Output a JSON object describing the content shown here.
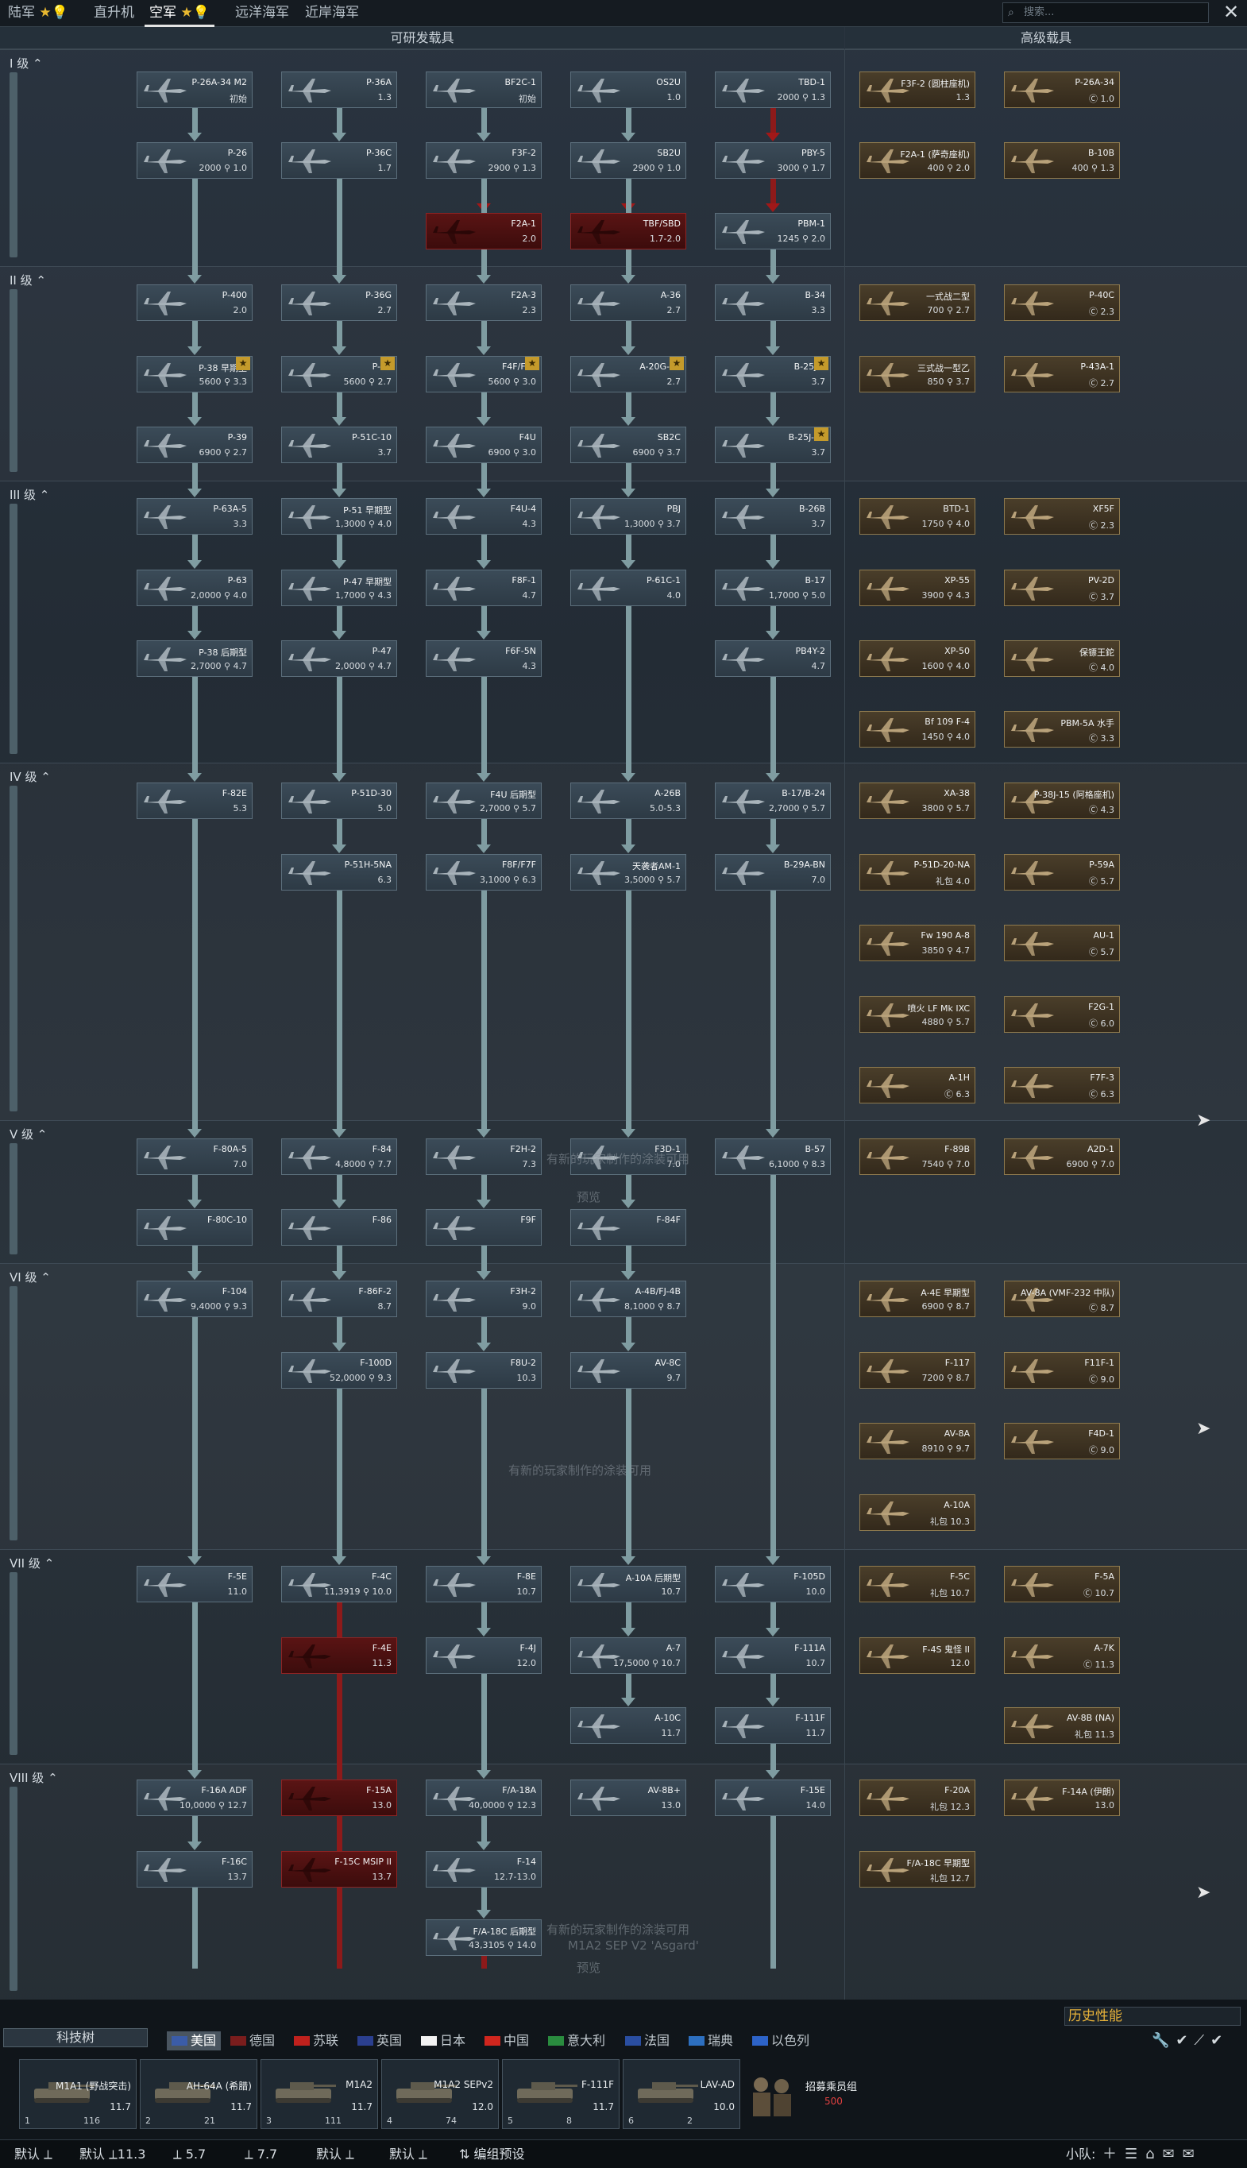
{
  "top_tabs": [
    {
      "label": "陆军",
      "badges": [
        "★",
        "💡"
      ],
      "active": false
    },
    {
      "label": "直升机",
      "badges": [],
      "active": false
    },
    {
      "label": "空军",
      "badges": [
        "★",
        "💡"
      ],
      "active": true
    },
    {
      "label": "远洋海军",
      "badges": [],
      "active": false
    },
    {
      "label": "近岸海军",
      "badges": [],
      "active": false
    }
  ],
  "search": {
    "placeholder": "搜索..."
  },
  "close_label": "✕",
  "headers": {
    "researchable": "可研发载具",
    "premium": "高级载具"
  },
  "ranks": [
    "I 级",
    "II 级",
    "III 级",
    "IV 级",
    "V 级",
    "VI 级",
    "VII 级",
    "VIII 级"
  ],
  "vehicles": [
    {
      "name": "P-26A-34 M2",
      "value": "初始",
      "type": "n"
    },
    {
      "name": "P-36A",
      "value": "1.3",
      "type": "n"
    },
    {
      "name": "BF2C-1",
      "value": "初始",
      "type": "n"
    },
    {
      "name": "OS2U",
      "value": "1.0",
      "type": "n"
    },
    {
      "name": "TBD-1",
      "value": "2000 ⚲ 1.3",
      "type": "n"
    },
    {
      "name": "F3F-2 (圆柱座机)",
      "value": "1.3",
      "type": "p"
    },
    {
      "name": "P-26A-34",
      "value": "Ⓒ 1.0",
      "type": "p"
    },
    {
      "name": "P-26",
      "value": "2000 ⚲ 1.0",
      "type": "n"
    },
    {
      "name": "P-36C",
      "value": "1.7",
      "type": "n"
    },
    {
      "name": "F3F-2",
      "value": "2900 ⚲ 1.3",
      "type": "n"
    },
    {
      "name": "SB2U",
      "value": "2900 ⚲ 1.0",
      "type": "n"
    },
    {
      "name": "PBY-5",
      "value": "3000 ⚲ 1.7",
      "type": "n"
    },
    {
      "name": "F2A-1 (萨奇座机)",
      "value": "400 ⚲ 2.0",
      "type": "p"
    },
    {
      "name": "B-10B",
      "value": "400 ⚲ 1.3",
      "type": "p"
    },
    {
      "name": "F2A-1",
      "value": "2.0",
      "type": "l"
    },
    {
      "name": "TBF/SBD",
      "value": "1.7-2.0",
      "type": "l"
    },
    {
      "name": "PBM-1",
      "value": "1245 ⚲ 2.0",
      "type": "n"
    },
    {
      "name": "P-400",
      "value": "2.0",
      "type": "n"
    },
    {
      "name": "P-36G",
      "value": "2.7",
      "type": "n"
    },
    {
      "name": "F2A-3",
      "value": "2.3",
      "type": "n"
    },
    {
      "name": "A-36",
      "value": "2.7",
      "type": "n"
    },
    {
      "name": "B-34",
      "value": "3.3",
      "type": "n"
    },
    {
      "name": "一式战二型",
      "value": "700 ⚲ 2.7",
      "type": "p"
    },
    {
      "name": "P-40C",
      "value": "Ⓒ 2.3",
      "type": "p"
    },
    {
      "name": "P-38 早期型",
      "value": "5600 ⚲ 3.3",
      "type": "n"
    },
    {
      "name": "P-40",
      "value": "5600 ⚲ 2.7",
      "type": "n"
    },
    {
      "name": "F4F/F6F",
      "value": "5600 ⚲ 3.0",
      "type": "n"
    },
    {
      "name": "A-20G-25",
      "value": "2.7",
      "type": "n"
    },
    {
      "name": "B-25J-1",
      "value": "3.7",
      "type": "n"
    },
    {
      "name": "三式战一型乙",
      "value": "850 ⚲ 3.7",
      "type": "p"
    },
    {
      "name": "P-43A-1",
      "value": "Ⓒ 2.7",
      "type": "p"
    },
    {
      "name": "P-39",
      "value": "6900 ⚲ 2.7",
      "type": "n"
    },
    {
      "name": "P-51C-10",
      "value": "3.7",
      "type": "n"
    },
    {
      "name": "F4U",
      "value": "6900 ⚲ 3.0",
      "type": "n"
    },
    {
      "name": "SB2C",
      "value": "6900 ⚲ 3.7",
      "type": "n"
    },
    {
      "name": "B-25J-20",
      "value": "3.7",
      "type": "n"
    },
    {
      "name": "P-63A-5",
      "value": "3.3",
      "type": "n"
    },
    {
      "name": "P-51 早期型",
      "value": "1,3000 ⚲ 4.0",
      "type": "n"
    },
    {
      "name": "F4U-4",
      "value": "4.3",
      "type": "n"
    },
    {
      "name": "PBJ",
      "value": "1,3000 ⚲ 3.7",
      "type": "n"
    },
    {
      "name": "B-26B",
      "value": "3.7",
      "type": "n"
    },
    {
      "name": "BTD-1",
      "value": "1750 ⚲ 4.0",
      "type": "p"
    },
    {
      "name": "XF5F",
      "value": "Ⓒ 2.3",
      "type": "p"
    },
    {
      "name": "P-63",
      "value": "2,0000 ⚲ 4.0",
      "type": "n"
    },
    {
      "name": "P-47 早期型",
      "value": "1,7000 ⚲ 4.3",
      "type": "n"
    },
    {
      "name": "F8F-1",
      "value": "4.7",
      "type": "n"
    },
    {
      "name": "P-61C-1",
      "value": "4.0",
      "type": "n"
    },
    {
      "name": "B-17",
      "value": "1,7000 ⚲ 5.0",
      "type": "n"
    },
    {
      "name": "XP-55",
      "value": "3900 ⚲ 4.3",
      "type": "p"
    },
    {
      "name": "PV-2D",
      "value": "Ⓒ 3.7",
      "type": "p"
    },
    {
      "name": "P-38 后期型",
      "value": "2,7000 ⚲ 4.7",
      "type": "n"
    },
    {
      "name": "P-47",
      "value": "2,0000 ⚲ 4.7",
      "type": "n"
    },
    {
      "name": "F6F-5N",
      "value": "4.3",
      "type": "n"
    },
    {
      "name": "PB4Y-2",
      "value": "4.7",
      "type": "n"
    },
    {
      "name": "XP-50",
      "value": "1600 ⚲ 4.0",
      "type": "p"
    },
    {
      "name": "保镖王鉈",
      "value": "Ⓒ 4.0",
      "type": "p"
    },
    {
      "name": "Bf 109 F-4",
      "value": "1450 ⚲ 4.0",
      "type": "p"
    },
    {
      "name": "PBM-5A 水手",
      "value": "Ⓒ 3.3",
      "type": "p"
    },
    {
      "name": "F-82E",
      "value": "5.3",
      "type": "n"
    },
    {
      "name": "P-51D-30",
      "value": "5.0",
      "type": "n"
    },
    {
      "name": "F4U 后期型",
      "value": "2,7000 ⚲ 5.7",
      "type": "n"
    },
    {
      "name": "A-26B",
      "value": "5.0-5.3",
      "type": "n"
    },
    {
      "name": "B-17/B-24",
      "value": "2,7000 ⚲ 5.7",
      "type": "n"
    },
    {
      "name": "XA-38",
      "value": "3800 ⚲ 5.7",
      "type": "p"
    },
    {
      "name": "P-38J-15 (阿格座机)",
      "value": "Ⓒ 4.3",
      "type": "p"
    },
    {
      "name": "P-51H-5NA",
      "value": "6.3",
      "type": "n"
    },
    {
      "name": "F8F/F7F",
      "value": "3,1000 ⚲ 6.3",
      "type": "n"
    },
    {
      "name": "天袭者AM-1",
      "value": "3,5000 ⚲ 5.7",
      "type": "n"
    },
    {
      "name": "B-29A-BN",
      "value": "7.0",
      "type": "n"
    },
    {
      "name": "P-51D-20-NA",
      "value": "礼包 4.0",
      "type": "p"
    },
    {
      "name": "P-59A",
      "value": "Ⓒ 5.7",
      "type": "p"
    },
    {
      "name": "Fw 190 A-8",
      "value": "3850 ⚲ 4.7",
      "type": "p"
    },
    {
      "name": "AU-1",
      "value": "Ⓒ 5.7",
      "type": "p"
    },
    {
      "name": "喷火 LF Mk IXC",
      "value": "4880 ⚲ 5.7",
      "type": "p"
    },
    {
      "name": "F2G-1",
      "value": "Ⓒ 6.0",
      "type": "p"
    },
    {
      "name": "A-1H",
      "value": "Ⓒ 6.3",
      "type": "p"
    },
    {
      "name": "F7F-3",
      "value": "Ⓒ 6.3",
      "type": "p"
    },
    {
      "name": "F-80A-5",
      "value": "7.0",
      "type": "n"
    },
    {
      "name": "F-84",
      "value": "4,8000 ⚲ 7.7",
      "type": "n"
    },
    {
      "name": "F2H-2",
      "value": "7.3",
      "type": "n"
    },
    {
      "name": "F3D-1",
      "value": "7.0",
      "type": "n"
    },
    {
      "name": "B-57",
      "value": "6,1000 ⚲ 8.3",
      "type": "n"
    },
    {
      "name": "F-89B",
      "value": "7540 ⚲ 7.0",
      "type": "p"
    },
    {
      "name": "A2D-1",
      "value": "6900 ⚲ 7.0",
      "type": "p"
    },
    {
      "name": "F-80C-10",
      "value": "",
      "type": "n"
    },
    {
      "name": "F-86",
      "value": "",
      "type": "n"
    },
    {
      "name": "F9F",
      "value": "",
      "type": "n"
    },
    {
      "name": "F-84F",
      "value": "",
      "type": "n"
    },
    {
      "name": "F-104",
      "value": "9,4000 ⚲ 9.3",
      "type": "n"
    },
    {
      "name": "F-86F-2",
      "value": "8.7",
      "type": "n"
    },
    {
      "name": "F3H-2",
      "value": "9.0",
      "type": "n"
    },
    {
      "name": "A-4B/FJ-4B",
      "value": "8,1000 ⚲ 8.7",
      "type": "n"
    },
    {
      "name": "A-4E 早期型",
      "value": "6900 ⚲ 8.7",
      "type": "p"
    },
    {
      "name": "AV-8A (VMF-232 中队)",
      "value": "Ⓒ 8.7",
      "type": "p"
    },
    {
      "name": "F-100D",
      "value": "52,0000 ⚲ 9.3",
      "type": "n"
    },
    {
      "name": "F8U-2",
      "value": "10.3",
      "type": "n"
    },
    {
      "name": "AV-8C",
      "value": "9.7",
      "type": "n"
    },
    {
      "name": "F-117",
      "value": "7200 ⚲ 8.7",
      "type": "p"
    },
    {
      "name": "F11F-1",
      "value": "Ⓒ 9.0",
      "type": "p"
    },
    {
      "name": "AV-8A",
      "value": "8910 ⚲ 9.7",
      "type": "p"
    },
    {
      "name": "F4D-1",
      "value": "Ⓒ 9.0",
      "type": "p"
    },
    {
      "name": "A-10A",
      "value": "礼包 10.3",
      "type": "p"
    },
    {
      "name": "F-5E",
      "value": "11.0",
      "type": "n"
    },
    {
      "name": "F-4C",
      "value": "11,3919 ⚲ 10.0",
      "type": "n"
    },
    {
      "name": "F-8E",
      "value": "10.7",
      "type": "n"
    },
    {
      "name": "A-10A 后期型",
      "value": "10.7",
      "type": "n"
    },
    {
      "name": "F-105D",
      "value": "10.0",
      "type": "n"
    },
    {
      "name": "F-5C",
      "value": "礼包 10.7",
      "type": "p"
    },
    {
      "name": "F-5A",
      "value": "Ⓒ 10.7",
      "type": "p"
    },
    {
      "name": "F-4E",
      "value": "11.3",
      "type": "l"
    },
    {
      "name": "F-4J",
      "value": "12.0",
      "type": "n"
    },
    {
      "name": "A-7",
      "value": "17,5000 ⚲ 10.7",
      "type": "n"
    },
    {
      "name": "F-111A",
      "value": "10.7",
      "type": "n"
    },
    {
      "name": "F-4S 鬼怪 II",
      "value": "12.0",
      "type": "p"
    },
    {
      "name": "A-7K",
      "value": "Ⓒ 11.3",
      "type": "p"
    },
    {
      "name": "A-10C",
      "value": "11.7",
      "type": "n"
    },
    {
      "name": "F-111F",
      "value": "11.7",
      "type": "n"
    },
    {
      "name": "AV-8B (NA)",
      "value": "礼包 11.3",
      "type": "p"
    },
    {
      "name": "F-16A ADF",
      "value": "10,0000 ⚲ 12.7",
      "type": "n"
    },
    {
      "name": "F-15A",
      "value": "13.0",
      "type": "l"
    },
    {
      "name": "F/A-18A",
      "value": "40,0000 ⚲ 12.3",
      "type": "n"
    },
    {
      "name": "AV-8B+",
      "value": "13.0",
      "type": "n"
    },
    {
      "name": "F-15E",
      "value": "14.0",
      "type": "n"
    },
    {
      "name": "F-20A",
      "value": "礼包 12.3",
      "type": "p"
    },
    {
      "name": "F-14A (伊朗)",
      "value": "13.0",
      "type": "p"
    },
    {
      "name": "F-16C",
      "value": "13.7",
      "type": "n"
    },
    {
      "name": "F-15C MSIP II",
      "value": "13.7",
      "type": "l"
    },
    {
      "name": "F-14",
      "value": "12.7-13.0",
      "type": "n"
    },
    {
      "name": "F/A-18C 早期型",
      "value": "礼包 12.7",
      "type": "p"
    },
    {
      "name": "F/A-18C 后期型",
      "value": "43,3105 ⚲ 14.0",
      "type": "n"
    }
  ],
  "notices": [
    "有新的玩家制作的涂装可用",
    "有新的玩家制作的涂装可用",
    "有新的玩家制作的涂装可用",
    "M1A2 SEP V2 'Asgard'",
    "预览",
    "预览"
  ],
  "bottom": {
    "tech_tree_label": "科技树",
    "history_label": "历史性能",
    "nations": [
      {
        "label": "美国",
        "active": true,
        "color": "#3b5ca8"
      },
      {
        "label": "德国",
        "active": false,
        "color": "#7a1d1d"
      },
      {
        "label": "苏联",
        "active": false,
        "color": "#c0211d"
      },
      {
        "label": "英国",
        "active": false,
        "color": "#2b3f8f"
      },
      {
        "label": "日本",
        "active": false,
        "color": "#f2f2f2"
      },
      {
        "label": "中国",
        "active": false,
        "color": "#d1261e"
      },
      {
        "label": "意大利",
        "active": false,
        "color": "#2a8c3f"
      },
      {
        "label": "法国",
        "active": false,
        "color": "#2a4ea1"
      },
      {
        "label": "瑞典",
        "active": false,
        "color": "#2d6fc0"
      },
      {
        "label": "以色列",
        "active": false,
        "color": "#2d63c8"
      }
    ],
    "slots": [
      {
        "name": "M1A1 (野战突击)",
        "br": "11.7",
        "num": "1",
        "stat": "116"
      },
      {
        "name": "AH-64A (希腊)",
        "br": "11.7",
        "num": "2",
        "stat": "21"
      },
      {
        "name": "M1A2",
        "br": "11.7",
        "num": "3",
        "stat": "111"
      },
      {
        "name": "M1A2 SEPv2",
        "br": "12.0",
        "num": "4",
        "stat": "74"
      },
      {
        "name": "F-111F",
        "br": "11.7",
        "num": "5",
        "stat": "8"
      },
      {
        "name": "LAV-AD",
        "br": "10.0",
        "num": "6",
        "stat": "2"
      }
    ],
    "crew": {
      "title": "招募乘员组",
      "cost": "500"
    },
    "status": [
      {
        "label": "默认 ⟂"
      },
      {
        "label": "默认 ⟂11.3"
      },
      {
        "label": "⟂ 5.7"
      },
      {
        "label": "⟂ 7.7"
      },
      {
        "label": "默认 ⟂"
      },
      {
        "label": "默认 ⟂"
      },
      {
        "label": "⇅ 编组预设"
      }
    ],
    "squad_label": "小队:",
    "tool_icons": "🔧✔⟋✔"
  },
  "colors": {
    "accent": "#e6b13a",
    "locked": "#8d1a1a",
    "line": "#7f9ca1"
  }
}
